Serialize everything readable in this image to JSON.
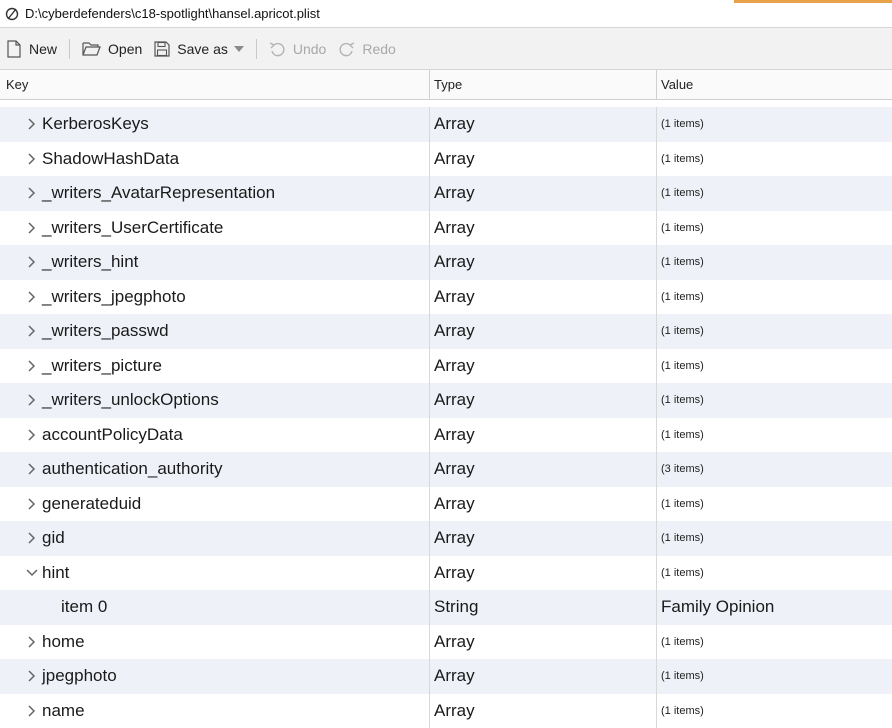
{
  "window": {
    "title": "D:\\cyberdefenders\\c18-spotlight\\hansel.apricot.plist"
  },
  "toolbar": {
    "new_label": "New",
    "open_label": "Open",
    "saveas_label": "Save as",
    "undo_label": "Undo",
    "redo_label": "Redo"
  },
  "table": {
    "headers": {
      "key": "Key",
      "type": "Type",
      "value": "Value"
    },
    "rows": [
      {
        "key": "KerberosKeys",
        "type": "Array",
        "value": "(1 items)",
        "state": "collapsed"
      },
      {
        "key": "ShadowHashData",
        "type": "Array",
        "value": "(1 items)",
        "state": "collapsed"
      },
      {
        "key": "_writers_AvatarRepresentation",
        "type": "Array",
        "value": "(1 items)",
        "state": "collapsed"
      },
      {
        "key": "_writers_UserCertificate",
        "type": "Array",
        "value": "(1 items)",
        "state": "collapsed"
      },
      {
        "key": "_writers_hint",
        "type": "Array",
        "value": "(1 items)",
        "state": "collapsed"
      },
      {
        "key": "_writers_jpegphoto",
        "type": "Array",
        "value": "(1 items)",
        "state": "collapsed"
      },
      {
        "key": "_writers_passwd",
        "type": "Array",
        "value": "(1 items)",
        "state": "collapsed"
      },
      {
        "key": "_writers_picture",
        "type": "Array",
        "value": "(1 items)",
        "state": "collapsed"
      },
      {
        "key": "_writers_unlockOptions",
        "type": "Array",
        "value": "(1 items)",
        "state": "collapsed"
      },
      {
        "key": "accountPolicyData",
        "type": "Array",
        "value": "(1 items)",
        "state": "collapsed"
      },
      {
        "key": "authentication_authority",
        "type": "Array",
        "value": "(3 items)",
        "state": "collapsed"
      },
      {
        "key": "generateduid",
        "type": "Array",
        "value": "(1 items)",
        "state": "collapsed"
      },
      {
        "key": "gid",
        "type": "Array",
        "value": "(1 items)",
        "state": "collapsed"
      },
      {
        "key": "hint",
        "type": "Array",
        "value": "(1 items)",
        "state": "expanded"
      },
      {
        "key": "item 0",
        "type": "String",
        "value": "Family Opinion",
        "state": "child"
      },
      {
        "key": "home",
        "type": "Array",
        "value": "(1 items)",
        "state": "collapsed"
      },
      {
        "key": "jpegphoto",
        "type": "Array",
        "value": "(1 items)",
        "state": "collapsed"
      },
      {
        "key": "name",
        "type": "Array",
        "value": "(1 items)",
        "state": "collapsed"
      }
    ]
  }
}
